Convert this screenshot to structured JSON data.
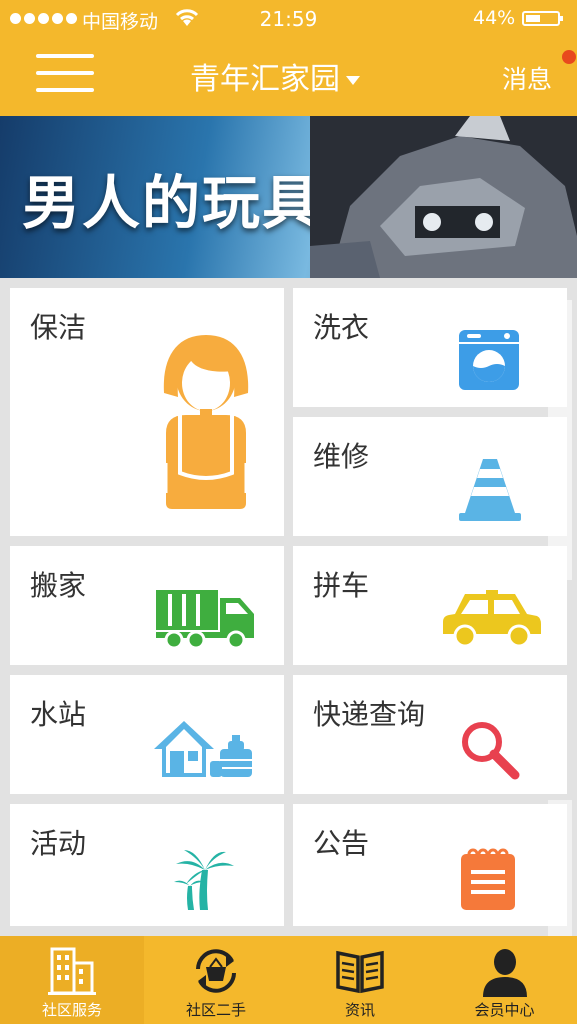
{
  "status_bar": {
    "carrier": "中国移动",
    "time": "21:59",
    "battery": "44%"
  },
  "header": {
    "title": "青年汇家园",
    "right_label": "消息"
  },
  "banner": {
    "slogan": "男人的玩具"
  },
  "services": {
    "cleaning": {
      "label": "保洁",
      "icon": "cleaning-lady-icon"
    },
    "laundry": {
      "label": "洗衣",
      "icon": "washing-machine-icon"
    },
    "repair": {
      "label": "维修",
      "icon": "traffic-cone-icon"
    },
    "moving": {
      "label": "搬家",
      "icon": "moving-truck-icon"
    },
    "carpool": {
      "label": "拼车",
      "icon": "car-icon"
    },
    "water": {
      "label": "水站",
      "icon": "water-station-icon"
    },
    "express": {
      "label": "快递查询",
      "icon": "search-icon"
    },
    "events": {
      "label": "活动",
      "icon": "palm-tree-icon"
    },
    "notice": {
      "label": "公告",
      "icon": "notepad-icon"
    }
  },
  "tabbar": {
    "community": "社区服务",
    "secondhand": "社区二手",
    "news": "资讯",
    "member": "会员中心"
  },
  "colors": {
    "brand": "#f4b82c",
    "icon_orange": "#f7ac3e",
    "icon_blue": "#3d9de7",
    "icon_green": "#3fae3f",
    "icon_yellow": "#ecc71e",
    "icon_red": "#e8414f"
  }
}
